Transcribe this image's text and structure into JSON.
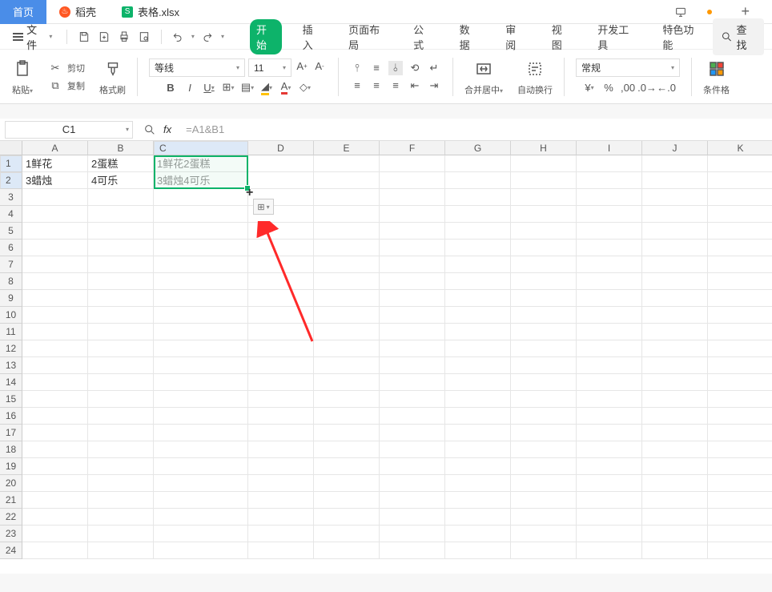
{
  "tabs": {
    "home": "首页",
    "daoke": "稻壳",
    "file": "表格.xlsx"
  },
  "file_menu": "文件",
  "ribbon_tabs": {
    "start": "开始",
    "insert": "插入",
    "layout": "页面布局",
    "formula": "公式",
    "data": "数据",
    "review": "审阅",
    "view": "视图",
    "dev": "开发工具",
    "special": "特色功能"
  },
  "search_label": "查找",
  "ribbon": {
    "paste": "粘贴",
    "cut": "剪切",
    "copy": "复制",
    "format_painter": "格式刷",
    "font_name": "等线",
    "font_size": "11",
    "merge": "合并居中",
    "wrap": "自动换行",
    "number_format": "常规",
    "conditional": "条件格"
  },
  "name_box": "C1",
  "formula": "=A1&B1",
  "columns": [
    "A",
    "B",
    "C",
    "D",
    "E",
    "F",
    "G",
    "H",
    "I",
    "J",
    "K"
  ],
  "rows": [
    "1",
    "2",
    "3",
    "4",
    "5",
    "6",
    "7",
    "8",
    "9",
    "10",
    "11",
    "12",
    "13",
    "14",
    "15",
    "16",
    "17",
    "18",
    "19",
    "20",
    "21",
    "22",
    "23",
    "24"
  ],
  "cells": {
    "A1": "1鲜花",
    "B1": "2蛋糕",
    "C1": "1鲜花2蛋糕",
    "A2": "3蜡烛",
    "B2": "4可乐",
    "C2": "3蜡烛4可乐"
  },
  "icons": {
    "daoke_glyph": "♨",
    "sheet_glyph": "S",
    "fx": "fx",
    "paste_opt": "⊞"
  }
}
